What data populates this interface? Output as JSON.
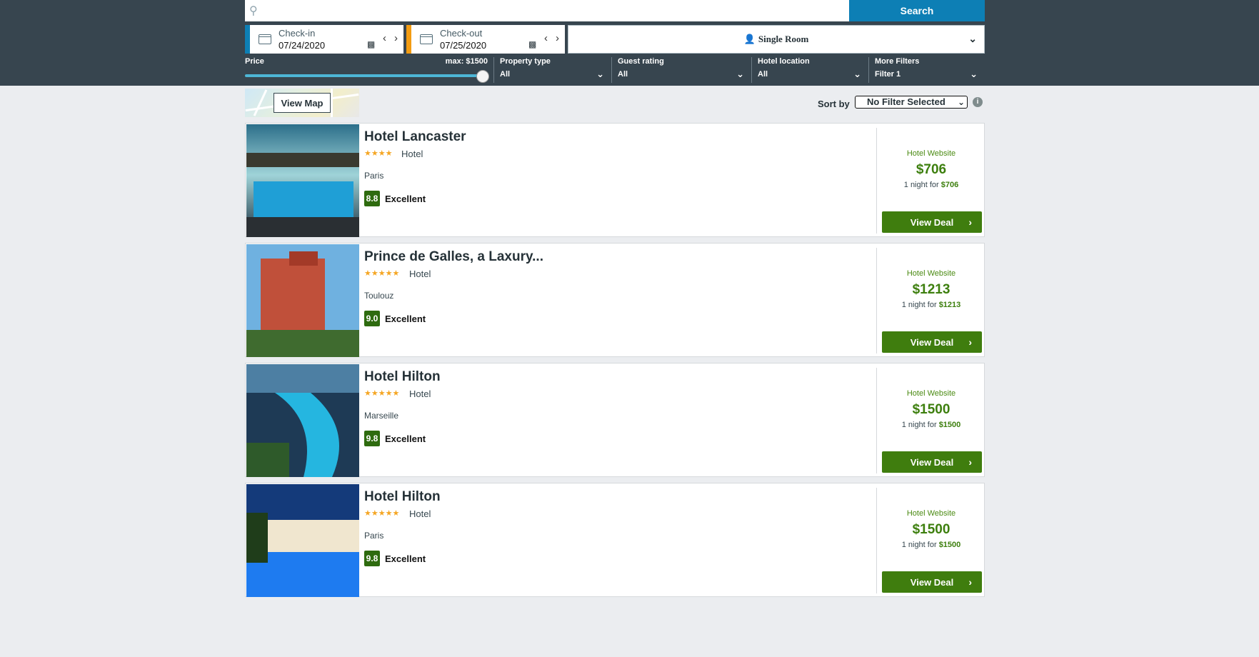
{
  "search": {
    "placeholder": "",
    "button_label": "Search"
  },
  "dates": {
    "checkin_label": "Check-in",
    "checkin_value": "07/24/2020",
    "checkout_label": "Check-out",
    "checkout_value": "07/25/2020"
  },
  "room": {
    "value": "Single Room"
  },
  "filters": {
    "price_label": "Price",
    "price_max_label": "max: $1500",
    "price_slider_fraction": 1.0,
    "property_type": {
      "label": "Property type",
      "value": "All"
    },
    "guest_rating": {
      "label": "Guest rating",
      "value": "All"
    },
    "hotel_location": {
      "label": "Hotel location",
      "value": "All"
    },
    "more_filters": {
      "label": "More Filters",
      "value": "Filter 1"
    }
  },
  "map": {
    "button_label": "View Map"
  },
  "sort": {
    "label": "Sort by",
    "value": "No Filter Selected",
    "info_icon": "i"
  },
  "colors": {
    "header": "#37454f",
    "accent_blue": "#0d7fb5",
    "checkout_orange": "#f39c12",
    "deal_green": "#3f7d0e",
    "star": "#f5a623"
  },
  "hotels": [
    {
      "name": "Hotel Lancaster",
      "stars": "★★★★",
      "type": "Hotel",
      "city": "Paris",
      "score": "8.8",
      "rating": "Excellent",
      "site": "Hotel Website",
      "price": "$706",
      "night_prefix": "1 night for ",
      "night_price": "$706",
      "deal": "View Deal"
    },
    {
      "name": "Prince de Galles, a Laxury...",
      "stars": "★★★★★",
      "type": "Hotel",
      "city": "Toulouz",
      "score": "9.0",
      "rating": "Excellent",
      "site": "Hotel Website",
      "price": "$1213",
      "night_prefix": "1 night for ",
      "night_price": "$1213",
      "deal": "View Deal"
    },
    {
      "name": "Hotel Hilton",
      "stars": "★★★★★",
      "type": "Hotel",
      "city": "Marseille",
      "score": "9.8",
      "rating": "Excellent",
      "site": "Hotel Website",
      "price": "$1500",
      "night_prefix": "1 night for ",
      "night_price": "$1500",
      "deal": "View Deal"
    },
    {
      "name": "Hotel Hilton",
      "stars": "★★★★★",
      "type": "Hotel",
      "city": "Paris",
      "score": "9.8",
      "rating": "Excellent",
      "site": "Hotel Website",
      "price": "$1500",
      "night_prefix": "1 night for ",
      "night_price": "$1500",
      "deal": "View Deal"
    }
  ]
}
